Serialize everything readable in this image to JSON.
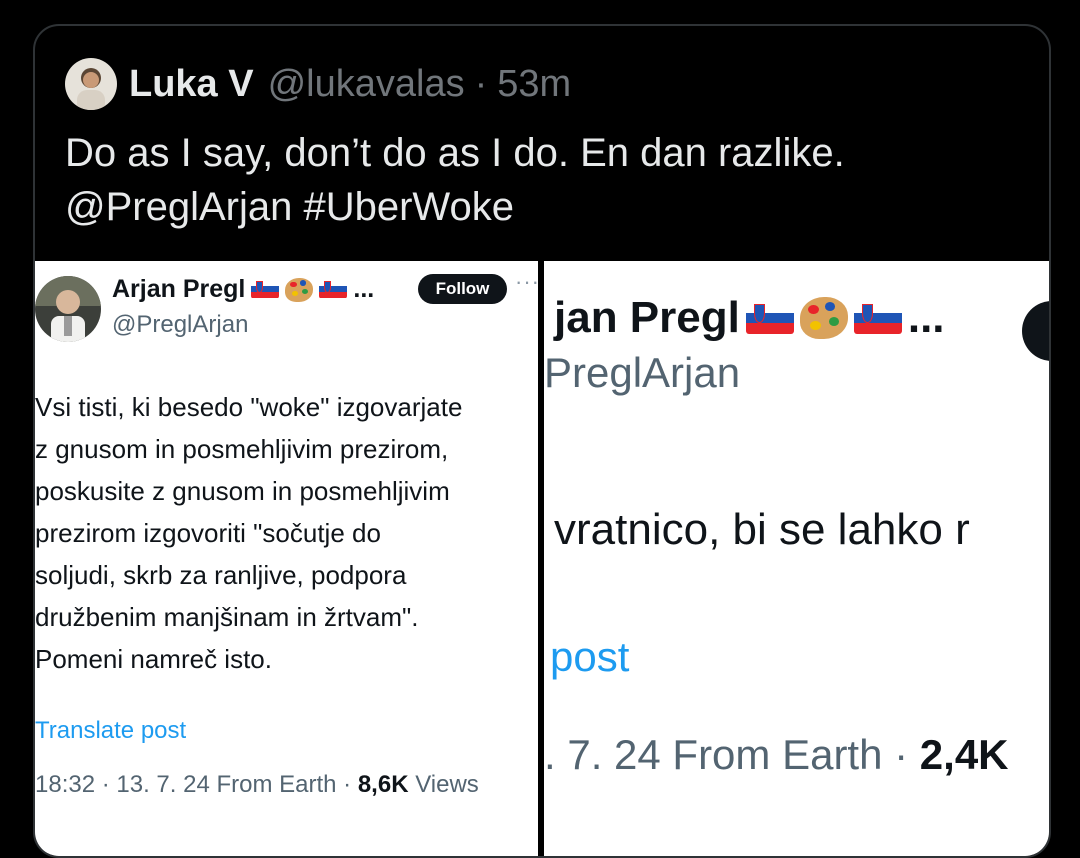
{
  "quote": {
    "name": "Luka V",
    "handle": "@lukavalas",
    "separator": "·",
    "time": "53m",
    "text_lines": [
      "Do as I say, don’t do as I do. En dan razlike.",
      "@PreglArjan #UberWoke"
    ]
  },
  "left_post": {
    "name": "Arjan Pregl",
    "name_suffix": "...",
    "handle": "@PreglArjan",
    "follow_label": "Follow",
    "more_label": "···",
    "body_lines": [
      "Vsi tisti, ki besedo \"woke\" izgovarjate",
      "z gnusom in posmehljivim prezirom,",
      "poskusite z gnusom in posmehljivim",
      "prezirom  izgovoriti \"sočutje do",
      "soljudi, skrb za ranljive, podpora",
      "družbenim manjšinam in žrtvam\".",
      "Pomeni namreč isto."
    ],
    "translate_label": "Translate post",
    "meta_prefix": "18:32 · 13. 7. 24 From Earth · ",
    "views_count": "8,6K",
    "views_label": " Views"
  },
  "right_post": {
    "name": "jan Pregl",
    "name_suffix": "...",
    "handle": "PreglArjan",
    "body": "vratnico, bi se lahko r",
    "translate_label": "post",
    "meta_prefix": ". 7. 24 From Earth · ",
    "views_count": "2,4K"
  },
  "colors": {
    "link_blue": "#1d9bf0",
    "slovenia_white": "#ffffff",
    "slovenia_blue": "#1f55b6",
    "slovenia_red": "#e8242a"
  },
  "icons": [
    "slovenia-flag-icon",
    "artist-palette-icon",
    "slovenia-flag-icon"
  ]
}
